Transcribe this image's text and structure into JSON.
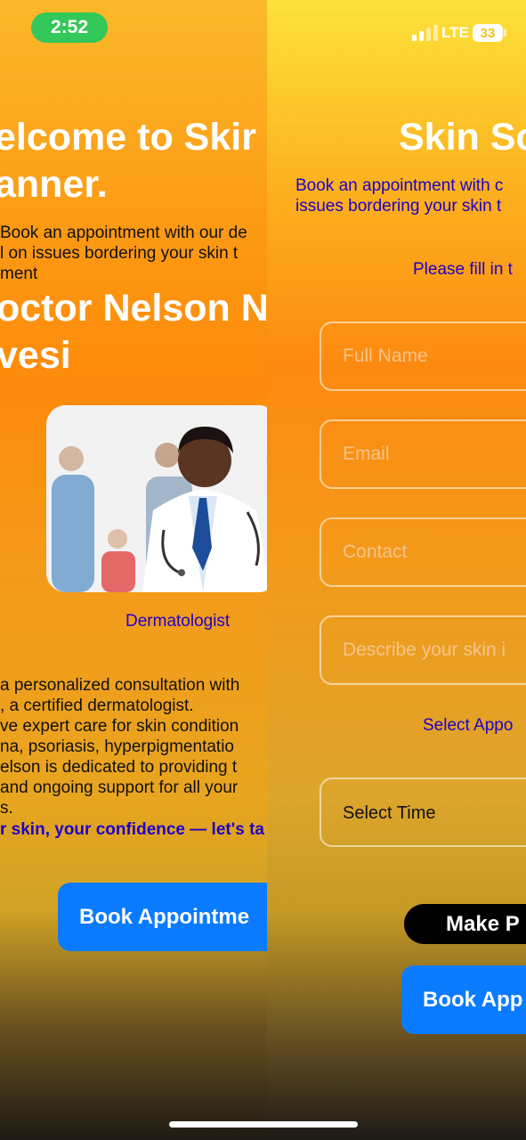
{
  "status_bar": {
    "time": "2:52",
    "network": "LTE",
    "battery": "33"
  },
  "left": {
    "title_line1": "elcome to Skir",
    "title_line2": "anner.",
    "intro_line1": "Book an appointment with our de",
    "intro_line2": "l on issues bordering your skin t",
    "intro_line3": "ment",
    "doctor_line1": "octor Nelson N",
    "doctor_line2": "vesi",
    "role": "Dermatologist",
    "desc": [
      "a personalized consultation with",
      ", a certified dermatologist.",
      "ve expert care for skin condition",
      "na, psoriasis, hyperpigmentatio",
      "elson is dedicated to providing t",
      "and ongoing support for all your",
      "s."
    ],
    "tagline": "r skin, your confidence — let's ta",
    "book_button": "Book Appointme"
  },
  "right": {
    "title": "Skin Sc",
    "intro_line1": "Book an appointment with c",
    "intro_line2": "issues bordering your skin t",
    "fill_prompt": "Please fill in t",
    "fields": {
      "full_name": "Full Name",
      "email": "Email",
      "contact": "Contact",
      "describe": "Describe your skin i"
    },
    "select_appointment": "Select Appo",
    "select_time": "Select Time",
    "make_button": "Make P",
    "book_button": "Book App"
  },
  "colors": {
    "accent": "#0a7bff",
    "link": "#1f00c8",
    "status_green": "#34c759"
  },
  "icons": [
    "signal-icon",
    "battery-icon"
  ]
}
